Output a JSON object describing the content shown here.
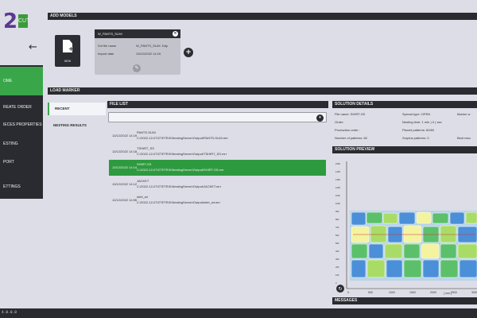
{
  "logo": {
    "number": "2",
    "tag": "CUT"
  },
  "nav": {
    "back_icon": "arrow-left-icon",
    "items": [
      {
        "label": "OME",
        "active": true
      },
      {
        "label": "REATE ORDER"
      },
      {
        "label": "IECES PROPERTIES"
      },
      {
        "label": "ESTING"
      },
      {
        "label": "PORT"
      },
      {
        "label": "ETTINGS"
      }
    ],
    "version": "4.0.0.0"
  },
  "add_models": {
    "header": "ADD MODELS",
    "new_label": "NEW",
    "card": {
      "title": "W_PANTS_SLIM",
      "dxf_label": "Dxf file name",
      "dxf_value": "W_PANTS_SLIM .Ddy",
      "import_label": "Import date",
      "import_value": "13/12/2022 14:19"
    }
  },
  "load_marker": {
    "header": "LOAD MARKER",
    "tabs": [
      "RECENT",
      "NESTING RESULTS"
    ],
    "file_list_header": "FILE LIST",
    "files": [
      {
        "date": "13/12/2022 14:19",
        "name": "PANTS-SLIM",
        "path": "C:\\2022-12-07\\ZTETRIX\\NestingServer\\Output\\PANTS-SLIM.mrr"
      },
      {
        "date": "13/12/2022 14:18",
        "name": "TSHIRT_SS",
        "path": "C:\\2022-12-07\\ZTETRIX\\NestingServer\\Output\\TSHIRT_SS.mrr"
      },
      {
        "date": "13/12/2022 14:14",
        "name": "SHIRT-SS",
        "path": "C:\\2022-12-07\\ZTETRIX\\NestingServer\\Output\\SHIRT-SS.mrr",
        "selected": true
      },
      {
        "date": "13/12/2022 14:12",
        "name": "JACKET",
        "path": "C:\\2022-12-07\\ZTETRIX\\NestingServer\\Output\\JACKET.mrr"
      },
      {
        "date": "12/12/2022 14:55",
        "name": "shirt_wt",
        "path": "C:\\2022-12-07\\ZTETRIX\\NestingServer\\Output\\shirt_wt.mrr"
      }
    ]
  },
  "solution_details": {
    "header": "SOLUTION DETAILS",
    "col1": [
      "File name: SHIRT-SS",
      "Order:",
      "Production order:",
      "Number of patterns: 60"
    ],
    "col2": [
      "Spread type: OPEN",
      "Nesting time: 1 min ) 0 ( sec",
      "Placed patterns: 60/60",
      "Surplus patterns: 0"
    ],
    "col3": [
      "Marker w",
      "",
      "",
      "Best resu"
    ]
  },
  "solution_preview": {
    "header": "SOLUTION PREVIEW",
    "x_ticks": [
      "0",
      "500",
      "1000",
      "1500",
      "2000",
      "2500",
      "3000"
    ],
    "x_unit": "[ mm ]",
    "y_ticks": [
      "1500",
      "1400",
      "1300",
      "1200",
      "1100",
      "1000",
      "900",
      "800",
      "700",
      "600",
      "500",
      "400",
      "300",
      "200",
      "100",
      "0"
    ],
    "y_unit": "[ mm ]"
  },
  "messages": {
    "header": "MESSAGES"
  },
  "colors": {
    "accent": "#3aa64a",
    "dark": "#2a2b30",
    "bg": "#dcdde6"
  }
}
